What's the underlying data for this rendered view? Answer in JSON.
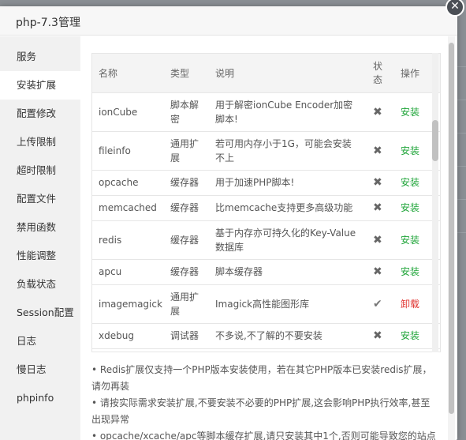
{
  "dialog": {
    "title": "php-7.3管理",
    "close_glyph": "✕"
  },
  "sidebar": {
    "items": [
      {
        "label": "服务"
      },
      {
        "label": "安装扩展"
      },
      {
        "label": "配置修改"
      },
      {
        "label": "上传限制"
      },
      {
        "label": "超时限制"
      },
      {
        "label": "配置文件"
      },
      {
        "label": "禁用函数"
      },
      {
        "label": "性能调整"
      },
      {
        "label": "负载状态"
      },
      {
        "label": "Session配置"
      },
      {
        "label": "日志"
      },
      {
        "label": "慢日志"
      },
      {
        "label": "phpinfo"
      }
    ],
    "active_index": 1
  },
  "table": {
    "headers": {
      "name": "名称",
      "type": "类型",
      "desc": "说明",
      "status": "状态",
      "op": "操作"
    },
    "rows": [
      {
        "name": "ionCube",
        "type": "脚本解密",
        "desc": "用于解密ionCube Encoder加密脚本!",
        "status": "✖",
        "op": "安装"
      },
      {
        "name": "fileinfo",
        "type": "通用扩展",
        "desc": "若可用内存小于1G，可能会安装不上",
        "status": "✖",
        "op": "安装"
      },
      {
        "name": "opcache",
        "type": "缓存器",
        "desc": "用于加速PHP脚本!",
        "status": "✖",
        "op": "安装"
      },
      {
        "name": "memcached",
        "type": "缓存器",
        "desc": "比memcache支持更多高级功能",
        "status": "✖",
        "op": "安装"
      },
      {
        "name": "redis",
        "type": "缓存器",
        "desc": "基于内存亦可持久化的Key-Value数据库",
        "status": "✖",
        "op": "安装"
      },
      {
        "name": "apcu",
        "type": "缓存器",
        "desc": "脚本缓存器",
        "status": "✖",
        "op": "安装"
      },
      {
        "name": "imagemagick",
        "type": "通用扩展",
        "desc": "Imagick高性能图形库",
        "status": "✔",
        "op": "卸载"
      },
      {
        "name": "xdebug",
        "type": "调试器",
        "desc": "不多说,不了解的不要安装",
        "status": "✖",
        "op": "安装"
      }
    ]
  },
  "notes": [
    "• Redis扩展仅支持一个PHP版本安装使用，若在其它PHP版本已安装redis扩展，请勿再装",
    "• 请按实际需求安装扩展,不要安装不必要的PHP扩展,这会影响PHP执行效率,甚至出现异常",
    "• opcache/xcache/apc等脚本缓存扩展,请只安装其中1个,否则可能导致您的站点"
  ],
  "colors": {
    "install": "#20a53a",
    "uninstall": "#e0332f"
  }
}
